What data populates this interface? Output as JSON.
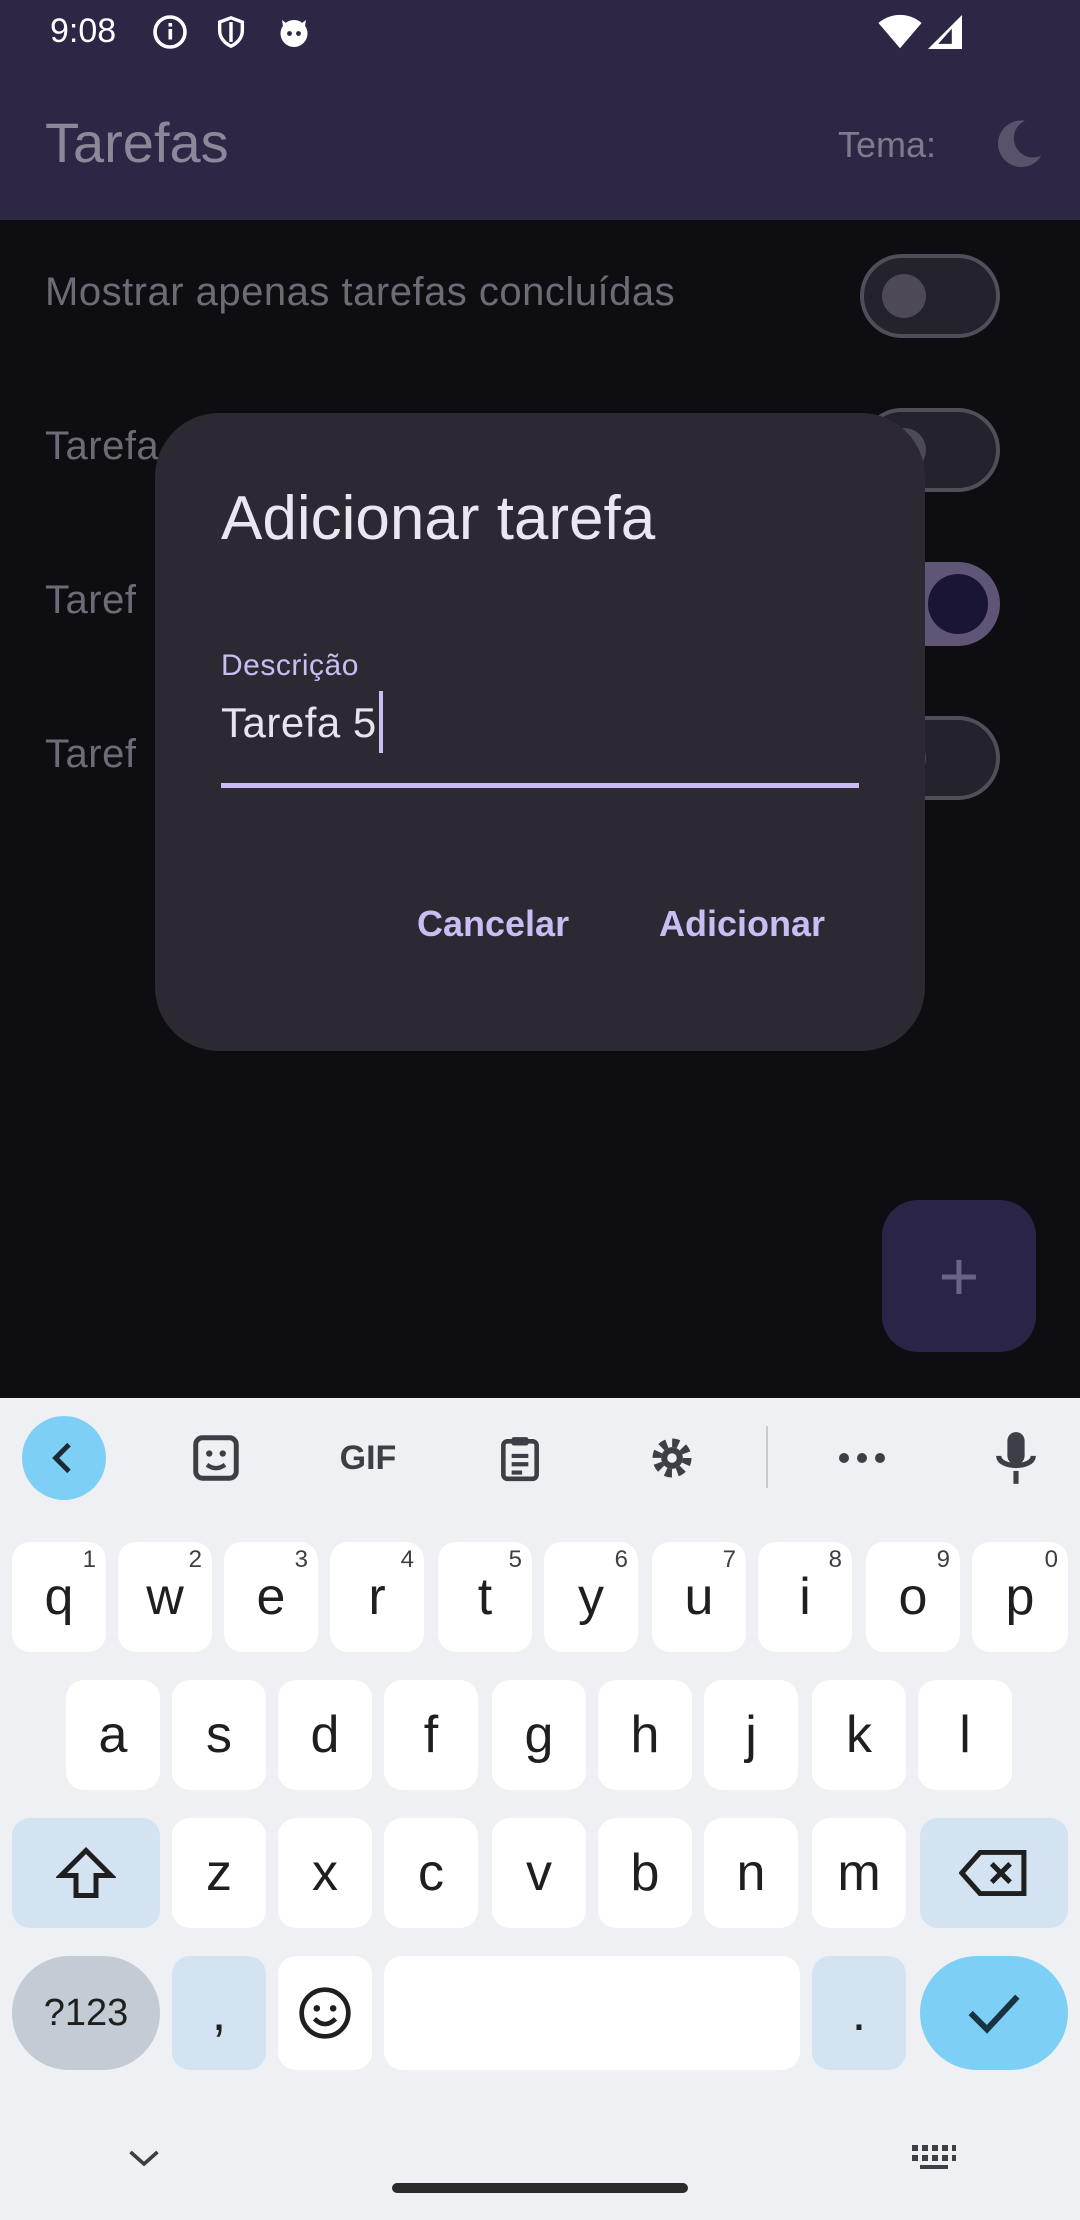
{
  "status": {
    "time": "9:08"
  },
  "appbar": {
    "title": "Tarefas",
    "theme_label": "Tema:"
  },
  "list": {
    "filter_label": "Mostrar apenas tarefas concluídas",
    "rows": [
      {
        "label": "Tarefa",
        "done": false
      },
      {
        "label": "Taref",
        "done": true
      },
      {
        "label": "Taref",
        "done": false
      }
    ]
  },
  "dialog": {
    "title": "Adicionar tarefa",
    "field_label": "Descrição",
    "field_value": "Tarefa 5",
    "cancel_label": "Cancelar",
    "add_label": "Adicionar"
  },
  "fab": {
    "icon": "+"
  },
  "keyboard": {
    "toolbar_gif": "GIF",
    "row1": [
      {
        "k": "q",
        "h": "1"
      },
      {
        "k": "w",
        "h": "2"
      },
      {
        "k": "e",
        "h": "3"
      },
      {
        "k": "r",
        "h": "4"
      },
      {
        "k": "t",
        "h": "5"
      },
      {
        "k": "y",
        "h": "6"
      },
      {
        "k": "u",
        "h": "7"
      },
      {
        "k": "i",
        "h": "8"
      },
      {
        "k": "o",
        "h": "9"
      },
      {
        "k": "p",
        "h": "0"
      }
    ],
    "row2": [
      "a",
      "s",
      "d",
      "f",
      "g",
      "h",
      "j",
      "k",
      "l"
    ],
    "row3": [
      "z",
      "x",
      "c",
      "v",
      "b",
      "n",
      "m"
    ],
    "sym_label": "?123",
    "comma": ",",
    "period": "."
  },
  "colors": {
    "accent": "#cbbcf4",
    "appbar": "#2d2645",
    "dialog": "#2c2932",
    "enter": "#7ecff6"
  }
}
